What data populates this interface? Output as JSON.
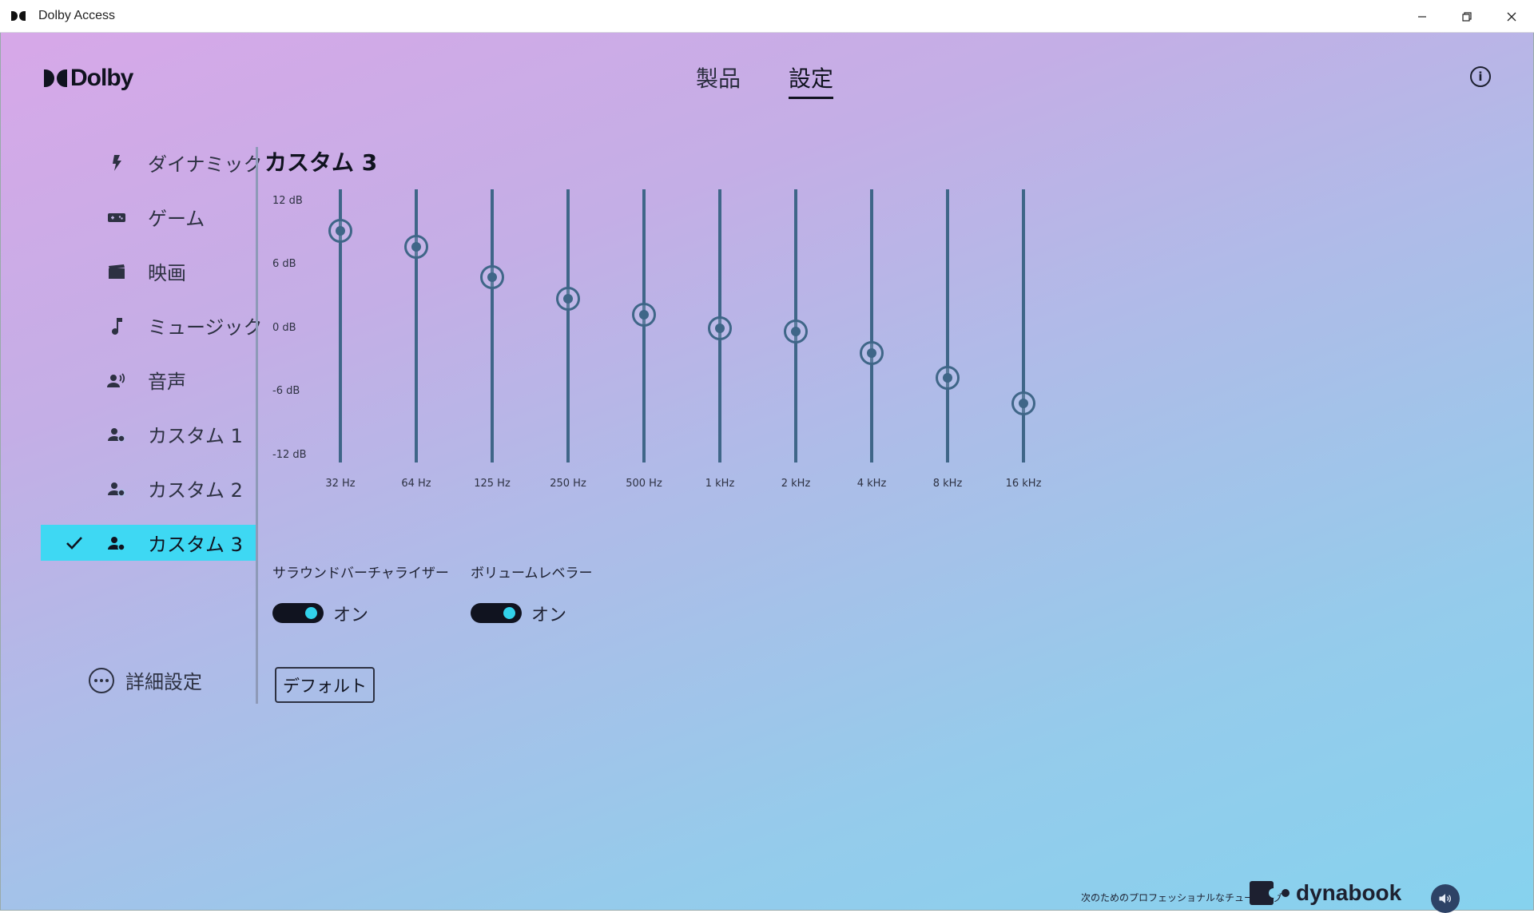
{
  "window": {
    "title": "Dolby Access"
  },
  "brand": {
    "name": "Dolby"
  },
  "nav": {
    "tabs": [
      {
        "label": "製品"
      },
      {
        "label": "設定",
        "active": true
      }
    ]
  },
  "info": {
    "label": "i"
  },
  "sidebar": {
    "items": [
      {
        "label": "ダイナミック",
        "icon": "lightning-icon"
      },
      {
        "label": "ゲーム",
        "icon": "gamepad-icon"
      },
      {
        "label": "映画",
        "icon": "clapperboard-icon"
      },
      {
        "label": "ミュージック",
        "icon": "music-note-icon"
      },
      {
        "label": "音声",
        "icon": "speaking-person-icon"
      },
      {
        "label": "カスタム 1",
        "icon": "custom-profile-icon"
      },
      {
        "label": "カスタム 2",
        "icon": "custom-profile-icon"
      },
      {
        "label": "カスタム 3",
        "icon": "custom-profile-icon",
        "active": true
      }
    ],
    "advanced_label": "詳細設定"
  },
  "preset": {
    "title": "カスタム 3"
  },
  "equalizer": {
    "y_labels": [
      "12 dB",
      "6 dB",
      "0 dB",
      "-6 dB",
      "-12 dB"
    ],
    "bands": [
      {
        "label": "32 Hz",
        "value": 10.1
      },
      {
        "label": "64 Hz",
        "value": 8.6
      },
      {
        "label": "125 Hz",
        "value": 5.7
      },
      {
        "label": "250 Hz",
        "value": 3.7
      },
      {
        "label": "500 Hz",
        "value": 2.2
      },
      {
        "label": "1 kHz",
        "value": 0.9
      },
      {
        "label": "2 kHz",
        "value": 0.6
      },
      {
        "label": "4 kHz",
        "value": -1.4
      },
      {
        "label": "8 kHz",
        "value": -3.8
      },
      {
        "label": "16 kHz",
        "value": -6.2
      }
    ]
  },
  "options": {
    "surround": {
      "label": "サラウンドバーチャライザー",
      "state": "オン"
    },
    "volume": {
      "label": "ボリュームレベラー",
      "state": "オン"
    }
  },
  "default_button": {
    "label": "デフォルト"
  },
  "footer": {
    "tagline": "次のためのプロフェッショナルなチューニング",
    "brand": "dynabook"
  },
  "colors": {
    "accent": "#3ed8f3",
    "slider": "#3f6688",
    "toggle_knob": "#32d2ea"
  }
}
